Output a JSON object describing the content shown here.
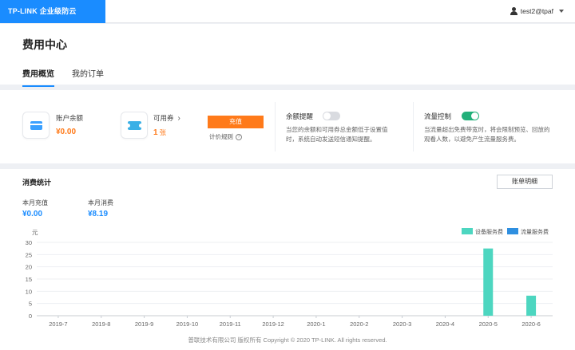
{
  "header": {
    "logo": "TP-LINK 企业级防云",
    "user": "test2@tpaf"
  },
  "page": {
    "title": "费用中心",
    "tabs": [
      {
        "label": "费用概览",
        "active": true
      },
      {
        "label": "我的订单",
        "active": false
      }
    ]
  },
  "summary": {
    "balance_label": "账户余额",
    "balance_value": "¥0.00",
    "coupon_label": "可用券",
    "coupon_count": "1",
    "coupon_unit": "张",
    "recharge_label": "充值",
    "pricing_label": "计价规则",
    "balance_alert": {
      "label": "余额提醒",
      "enabled": false,
      "description": "当您的余额和可用券总金额低于设置值时，系统自动发送短信通知提醒。"
    },
    "traffic_control": {
      "label": "流量控制",
      "enabled": true,
      "description": "当流量超出免费带宽时，将会限制预览、回放的观看人数，以避免产生流量服务费。"
    }
  },
  "stats": {
    "title": "消费统计",
    "bill_button": "账单明细",
    "month_recharge_label": "本月充值",
    "month_recharge_value": "¥0.00",
    "month_spend_label": "本月消费",
    "month_spend_value": "¥8.19"
  },
  "colors": {
    "accent": "#1a8cff",
    "orange": "#ff7a1a",
    "toggle_on": "#22b07a",
    "device_series": "#4dd6c0",
    "traffic_series": "#2f8fe0"
  },
  "chart_data": {
    "type": "bar",
    "ylabel": "元",
    "ylim": [
      0,
      30
    ],
    "yticks": [
      0,
      5,
      10,
      15,
      20,
      25,
      30
    ],
    "categories": [
      "2019-7",
      "2019-8",
      "2019-9",
      "2019-10",
      "2019-11",
      "2019-12",
      "2020-1",
      "2020-2",
      "2020-3",
      "2020-4",
      "2020-5",
      "2020-6"
    ],
    "series": [
      {
        "name": "设备服务费",
        "values": [
          0,
          0,
          0,
          0,
          0,
          0,
          0,
          0,
          0,
          0,
          27.5,
          8.2
        ]
      },
      {
        "name": "流量服务费",
        "values": [
          0,
          0,
          0,
          0,
          0,
          0,
          0,
          0,
          0,
          0,
          0,
          0
        ]
      }
    ],
    "legend_position": "top-right",
    "grid": true
  },
  "footer": {
    "text": "普联技术有限公司 版权所有 Copyright © 2020 TP-LINK. All rights reserved."
  }
}
